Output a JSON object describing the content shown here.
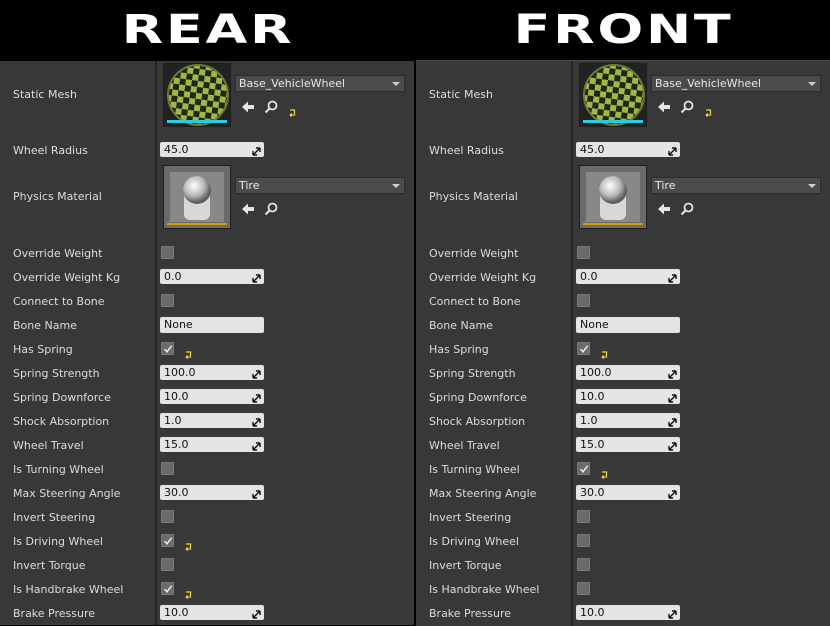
{
  "headers": {
    "rear": "REAR",
    "front": "FRONT"
  },
  "panels": {
    "rear": {
      "static_mesh": {
        "label": "Static Mesh",
        "asset": "Base_VehicleWheel"
      },
      "wheel_radius": {
        "label": "Wheel Radius",
        "value": "45.0"
      },
      "physics_material": {
        "label": "Physics Material",
        "asset": "Tire"
      },
      "override_weight": {
        "label": "Override Weight",
        "checked": false
      },
      "override_weight_kg": {
        "label": "Override Weight Kg",
        "value": "0.0"
      },
      "connect_to_bone": {
        "label": "Connect to Bone",
        "checked": false
      },
      "bone_name": {
        "label": "Bone Name",
        "value": "None"
      },
      "has_spring": {
        "label": "Has Spring",
        "checked": true
      },
      "spring_strength": {
        "label": "Spring Strength",
        "value": "100.0"
      },
      "spring_downforce": {
        "label": "Spring Downforce",
        "value": "10.0"
      },
      "shock_absorption": {
        "label": "Shock Absorption",
        "value": "1.0"
      },
      "wheel_travel": {
        "label": "Wheel Travel",
        "value": "15.0"
      },
      "is_turning_wheel": {
        "label": "Is Turning Wheel",
        "checked": false
      },
      "max_steering_angle": {
        "label": "Max Steering Angle",
        "value": "30.0"
      },
      "invert_steering": {
        "label": "Invert Steering",
        "checked": false
      },
      "is_driving_wheel": {
        "label": "Is Driving Wheel",
        "checked": true
      },
      "invert_torque": {
        "label": "Invert Torque",
        "checked": false
      },
      "is_handbrake_wheel": {
        "label": "Is Handbrake Wheel",
        "checked": true
      },
      "brake_pressure": {
        "label": "Brake Pressure",
        "value": "10.0"
      }
    },
    "front": {
      "static_mesh": {
        "label": "Static Mesh",
        "asset": "Base_VehicleWheel"
      },
      "wheel_radius": {
        "label": "Wheel Radius",
        "value": "45.0"
      },
      "physics_material": {
        "label": "Physics Material",
        "asset": "Tire"
      },
      "override_weight": {
        "label": "Override Weight",
        "checked": false
      },
      "override_weight_kg": {
        "label": "Override Weight Kg",
        "value": "0.0"
      },
      "connect_to_bone": {
        "label": "Connect to Bone",
        "checked": false
      },
      "bone_name": {
        "label": "Bone Name",
        "value": "None"
      },
      "has_spring": {
        "label": "Has Spring",
        "checked": true
      },
      "spring_strength": {
        "label": "Spring Strength",
        "value": "100.0"
      },
      "spring_downforce": {
        "label": "Spring Downforce",
        "value": "10.0"
      },
      "shock_absorption": {
        "label": "Shock Absorption",
        "value": "1.0"
      },
      "wheel_travel": {
        "label": "Wheel Travel",
        "value": "15.0"
      },
      "is_turning_wheel": {
        "label": "Is Turning Wheel",
        "checked": true
      },
      "max_steering_angle": {
        "label": "Max Steering Angle",
        "value": "30.0"
      },
      "invert_steering": {
        "label": "Invert Steering",
        "checked": false
      },
      "is_driving_wheel": {
        "label": "Is Driving Wheel",
        "checked": false
      },
      "invert_torque": {
        "label": "Invert Torque",
        "checked": false
      },
      "is_handbrake_wheel": {
        "label": "Is Handbrake Wheel",
        "checked": false
      },
      "brake_pressure": {
        "label": "Brake Pressure",
        "value": "10.0"
      }
    }
  },
  "colors": {
    "panel_bg": "#383838",
    "field_bg": "#e4e4e4",
    "reset_arrow": "#e6d23a",
    "thumb_accent": "#2ecbe0"
  },
  "icons": {
    "browse": "arrow-left-icon",
    "find": "magnifier-icon",
    "reset": "reset-to-default-icon",
    "drag": "drag-handle-icon"
  }
}
